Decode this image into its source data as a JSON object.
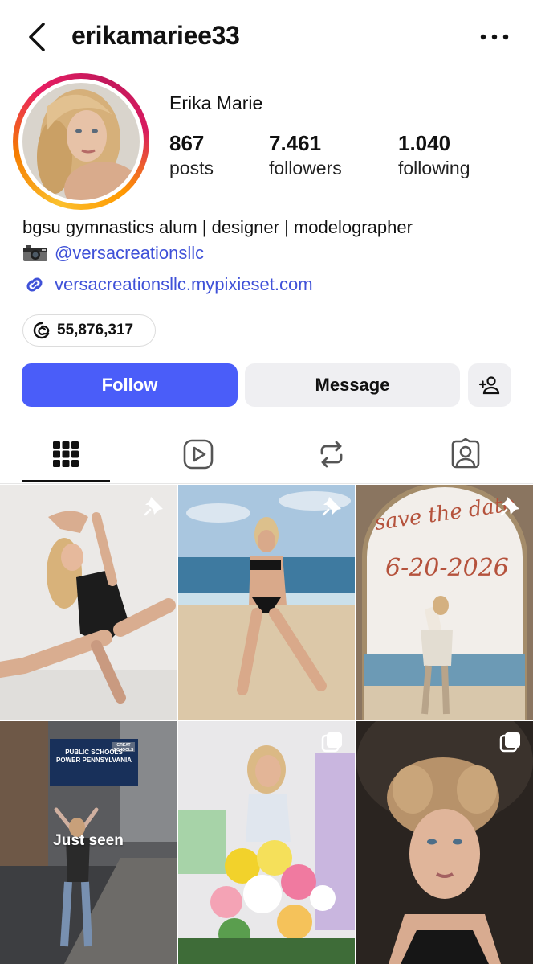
{
  "header": {
    "username": "erikamariee33",
    "back_icon": "chevron-left-icon",
    "more_icon": "more-horizontal-icon"
  },
  "profile": {
    "display_name": "Erika Marie",
    "stats": [
      {
        "value": "867",
        "label": "posts"
      },
      {
        "value": "7.461",
        "label": "followers"
      },
      {
        "value": "1.040",
        "label": "following"
      }
    ],
    "bio_line": "bgsu gymnastics alum | designer | modelographer",
    "mention": "@versacreationsllc",
    "link": "versacreationsllc.mypixieset.com",
    "threads_count": "55,876,317"
  },
  "actions": {
    "follow_label": "Follow",
    "message_label": "Message"
  },
  "tabs": [
    {
      "name": "grid",
      "icon": "grid-icon",
      "active": true
    },
    {
      "name": "reels",
      "icon": "reels-icon",
      "active": false
    },
    {
      "name": "reposts",
      "icon": "repost-icon",
      "active": false
    },
    {
      "name": "tagged",
      "icon": "tagged-user-icon",
      "active": false
    }
  ],
  "posts": {
    "overlay_text": "Just seen",
    "tile_3_text_line1": "save the date",
    "tile_3_text_line2": "6-20-2026",
    "billboard_line1": "PUBLIC SCHOOLS",
    "billboard_line2": "POWER PENNSYLVANIA",
    "billboard_logo": "GREAT SCHOOLS"
  },
  "colors": {
    "accent": "#4a5df9",
    "link": "#3f51d8"
  }
}
